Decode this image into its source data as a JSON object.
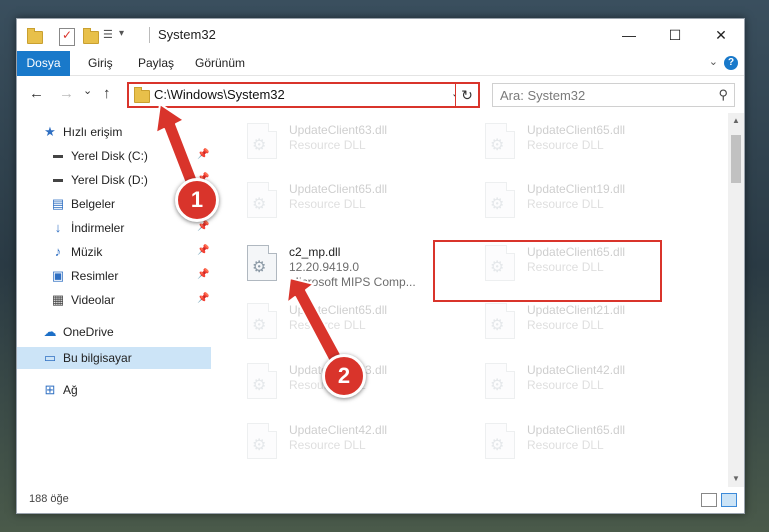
{
  "window": {
    "title": "System32",
    "controls": {
      "minimize": "—",
      "maximize": "☐",
      "close": "✕"
    }
  },
  "ribbon": {
    "tabs": [
      "Dosya",
      "Giriş",
      "Paylaş",
      "Görünüm"
    ],
    "help": "?"
  },
  "nav": {
    "back": "←",
    "forward": "→",
    "recent": "⌄",
    "up": "↑",
    "address": "C:\\Windows\\System32",
    "address_dropdown": "⌄",
    "refresh": "↻",
    "search_placeholder": "Ara: System32"
  },
  "sidebar": {
    "items": [
      {
        "label": "Hızlı erişim",
        "icon": "star-icon",
        "pinned": false
      },
      {
        "label": "Yerel Disk (C:)",
        "icon": "drive-icon",
        "pinned": true
      },
      {
        "label": "Yerel Disk (D:)",
        "icon": "drive-icon",
        "pinned": true
      },
      {
        "label": "Belgeler",
        "icon": "documents-icon",
        "pinned": true
      },
      {
        "label": "İndirmeler",
        "icon": "download-icon",
        "pinned": true
      },
      {
        "label": "Müzik",
        "icon": "music-icon",
        "pinned": true
      },
      {
        "label": "Resimler",
        "icon": "pictures-icon",
        "pinned": true
      },
      {
        "label": "Videolar",
        "icon": "videos-icon",
        "pinned": true
      },
      {
        "label": "OneDrive",
        "icon": "cloud-icon",
        "pinned": false
      },
      {
        "label": "Bu bilgisayar",
        "icon": "computer-icon",
        "pinned": false,
        "selected": true
      },
      {
        "label": "Ağ",
        "icon": "network-icon",
        "pinned": false
      }
    ]
  },
  "files": {
    "col1": [
      {
        "name": "UpdateClient63.dll",
        "desc": "Resource DLL"
      },
      {
        "name": "UpdateClient65.dll",
        "desc": "Resource DLL"
      },
      {
        "name": "c2_mp.dll",
        "version": "12.20.9419.0",
        "company": "Microsoft MIPS Comp...",
        "highlight": true
      },
      {
        "name": "UpdateClient65.dll",
        "desc": "Resource DLL"
      },
      {
        "name": "UpdateClient63.dll",
        "desc": "Resource DLL"
      },
      {
        "name": "UpdateClient42.dll",
        "desc": "Resource DLL"
      }
    ],
    "col2": [
      {
        "name": "UpdateClient65.dll",
        "desc": "Resource DLL"
      },
      {
        "name": "UpdateClient19.dll",
        "desc": "Resource DLL"
      },
      {
        "name": "UpdateClient65.dll",
        "desc": "Resource DLL"
      },
      {
        "name": "UpdateClient21.dll",
        "desc": "Resource DLL"
      },
      {
        "name": "UpdateClient42.dll",
        "desc": "Resource DLL"
      },
      {
        "name": "UpdateClient65.dll",
        "desc": "Resource DLL"
      }
    ]
  },
  "status": {
    "count": "188 öğe"
  },
  "callouts": [
    "1",
    "2"
  ],
  "colors": {
    "accent": "#1979ca",
    "callout": "#d9342b",
    "selected": "#cce4f7"
  }
}
